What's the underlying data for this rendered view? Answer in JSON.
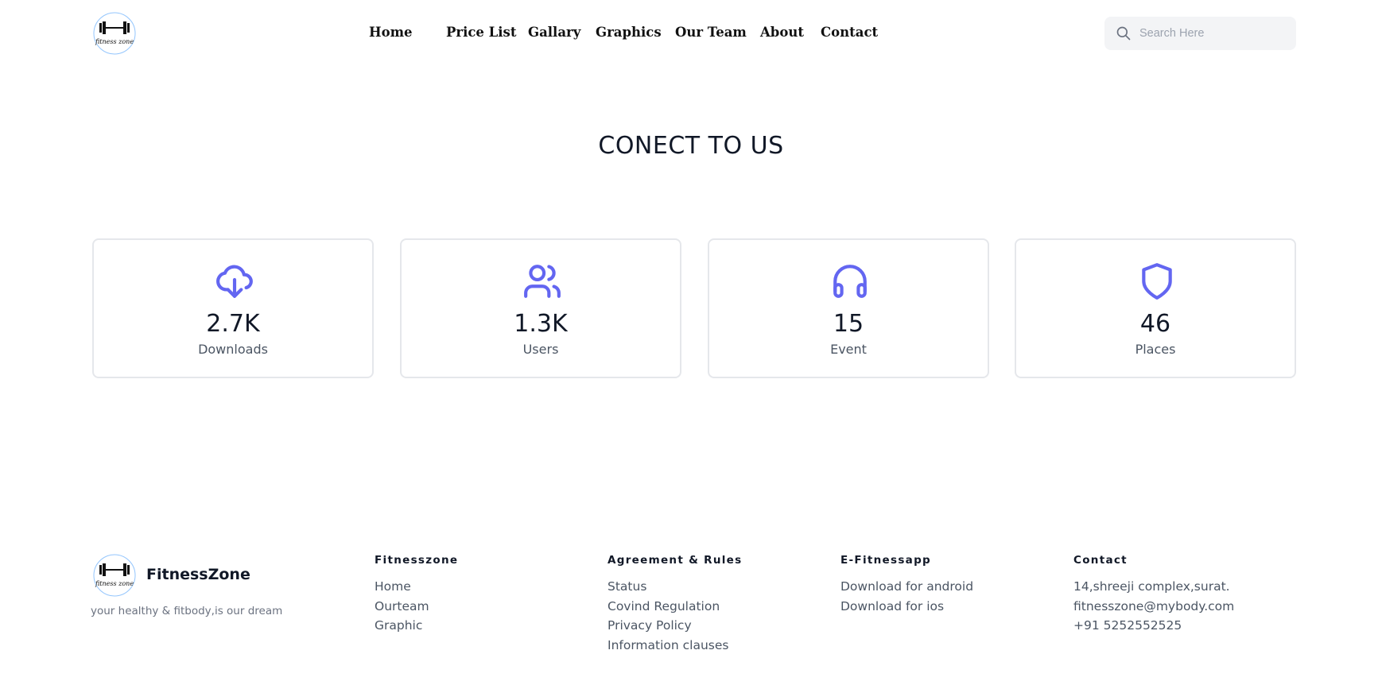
{
  "header": {
    "logo_text": "fitness zone",
    "nav": [
      {
        "label": "Home"
      },
      {
        "label": "Price List"
      },
      {
        "label": "Gallary"
      },
      {
        "label": "Graphics"
      },
      {
        "label": "Our Team"
      },
      {
        "label": "About"
      },
      {
        "label": "Contact"
      }
    ],
    "search": {
      "placeholder": "Search Here",
      "value": "",
      "icon": "search-icon"
    }
  },
  "main": {
    "title": "CONECT TO US",
    "accent_color": "#6366f1",
    "stats": [
      {
        "value": "2.7K",
        "label": "Downloads",
        "icon": "cloud-download-icon"
      },
      {
        "value": "1.3K",
        "label": "Users",
        "icon": "users-icon"
      },
      {
        "value": "15",
        "label": "Event",
        "icon": "headphones-icon"
      },
      {
        "value": "46",
        "label": "Places",
        "icon": "shield-icon"
      }
    ]
  },
  "footer": {
    "brand": "FitnessZone",
    "logo_text": "fitness zone",
    "tagline": "your healthy & fitbody,is our dream",
    "columns": [
      {
        "title": "Fitnesszone",
        "links": [
          "Home",
          "Ourteam",
          "Graphic"
        ]
      },
      {
        "title": "Agreement & Rules",
        "links": [
          "Status",
          "Covind Regulation",
          "Privacy Policy",
          "Information clauses"
        ]
      },
      {
        "title": "E-Fitnessapp",
        "links": [
          "Download for android",
          "Download for ios"
        ]
      },
      {
        "title": "Contact",
        "links": [
          "14,shreeji complex,surat.",
          "fitnesszone@mybody.com",
          "+91 5252552525"
        ]
      }
    ]
  }
}
